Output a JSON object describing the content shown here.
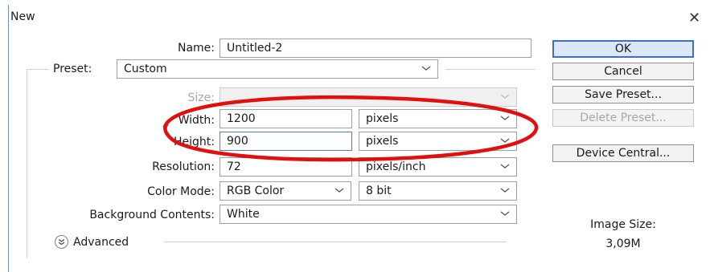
{
  "window": {
    "title": "New",
    "close_glyph": "✕"
  },
  "form": {
    "name": {
      "label": "Name:",
      "value": "Untitled-2"
    },
    "preset": {
      "label": "Preset:",
      "value": "Custom"
    },
    "size": {
      "label": "Size:",
      "value": ""
    },
    "width": {
      "label": "Width:",
      "value": "1200",
      "unit": "pixels"
    },
    "height": {
      "label": "Height:",
      "value": "900",
      "unit": "pixels"
    },
    "resolution": {
      "label": "Resolution:",
      "value": "72",
      "unit": "pixels/inch"
    },
    "color_mode": {
      "label": "Color Mode:",
      "value": "RGB Color",
      "depth": "8 bit"
    },
    "background": {
      "label": "Background Contents:",
      "value": "White"
    },
    "advanced": {
      "label": "Advanced"
    }
  },
  "buttons": {
    "ok": "OK",
    "cancel": "Cancel",
    "save_preset": "Save Preset...",
    "delete_preset": "Delete Preset...",
    "device_central": "Device Central..."
  },
  "image_size": {
    "label": "Image Size:",
    "value": "3,09M"
  },
  "annotation": {
    "color": "#e01010"
  },
  "colors": {
    "accent": "#3d6fc7",
    "focus": "#4f7cc8"
  }
}
